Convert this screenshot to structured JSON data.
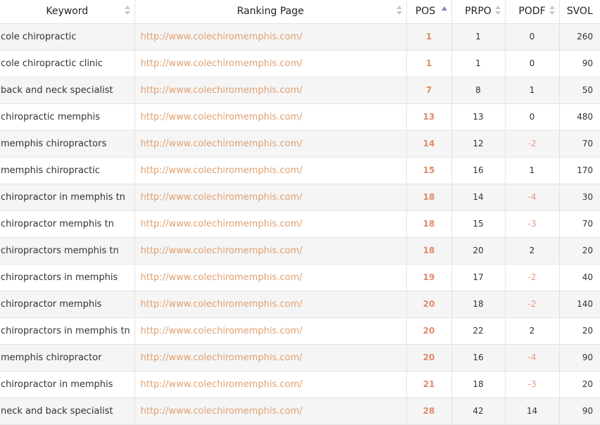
{
  "columns": {
    "keyword": "Keyword",
    "ranking_page": "Ranking Page",
    "pos": "POS",
    "prpo": "PRPO",
    "podf": "PODF",
    "svol": "SVOL"
  },
  "sort": {
    "column": "POS",
    "direction": "ascending"
  },
  "colors": {
    "link": "#e0a070",
    "position": "#e08a6a",
    "negative": "#e49880",
    "sort_active": "#7b86c8",
    "stripe": "#f5f5f5"
  },
  "rows": [
    {
      "keyword": "cole chiropractic",
      "page": "http://www.colechiromemphis.com/",
      "pos": "1",
      "prpo": "1",
      "podf": "0",
      "svol": "260"
    },
    {
      "keyword": "cole chiropractic clinic",
      "page": "http://www.colechiromemphis.com/",
      "pos": "1",
      "prpo": "1",
      "podf": "0",
      "svol": "90"
    },
    {
      "keyword": "back and neck specialist",
      "page": "http://www.colechiromemphis.com/",
      "pos": "7",
      "prpo": "8",
      "podf": "1",
      "svol": "50"
    },
    {
      "keyword": "chiropractic memphis",
      "page": "http://www.colechiromemphis.com/",
      "pos": "13",
      "prpo": "13",
      "podf": "0",
      "svol": "480"
    },
    {
      "keyword": "memphis chiropractors",
      "page": "http://www.colechiromemphis.com/",
      "pos": "14",
      "prpo": "12",
      "podf": "-2",
      "svol": "70"
    },
    {
      "keyword": "memphis chiropractic",
      "page": "http://www.colechiromemphis.com/",
      "pos": "15",
      "prpo": "16",
      "podf": "1",
      "svol": "170"
    },
    {
      "keyword": "chiropractor in memphis tn",
      "page": "http://www.colechiromemphis.com/",
      "pos": "18",
      "prpo": "14",
      "podf": "-4",
      "svol": "30"
    },
    {
      "keyword": "chiropractor memphis tn",
      "page": "http://www.colechiromemphis.com/",
      "pos": "18",
      "prpo": "15",
      "podf": "-3",
      "svol": "70"
    },
    {
      "keyword": "chiropractors memphis tn",
      "page": "http://www.colechiromemphis.com/",
      "pos": "18",
      "prpo": "20",
      "podf": "2",
      "svol": "20"
    },
    {
      "keyword": "chiropractors in memphis",
      "page": "http://www.colechiromemphis.com/",
      "pos": "19",
      "prpo": "17",
      "podf": "-2",
      "svol": "40"
    },
    {
      "keyword": "chiropractor memphis",
      "page": "http://www.colechiromemphis.com/",
      "pos": "20",
      "prpo": "18",
      "podf": "-2",
      "svol": "140"
    },
    {
      "keyword": "chiropractors in memphis tn",
      "page": "http://www.colechiromemphis.com/",
      "pos": "20",
      "prpo": "22",
      "podf": "2",
      "svol": "20"
    },
    {
      "keyword": "memphis chiropractor",
      "page": "http://www.colechiromemphis.com/",
      "pos": "20",
      "prpo": "16",
      "podf": "-4",
      "svol": "90"
    },
    {
      "keyword": "chiropractor in memphis",
      "page": "http://www.colechiromemphis.com/",
      "pos": "21",
      "prpo": "18",
      "podf": "-3",
      "svol": "20"
    },
    {
      "keyword": "neck and back specialist",
      "page": "http://www.colechiromemphis.com/",
      "pos": "28",
      "prpo": "42",
      "podf": "14",
      "svol": "90"
    }
  ]
}
